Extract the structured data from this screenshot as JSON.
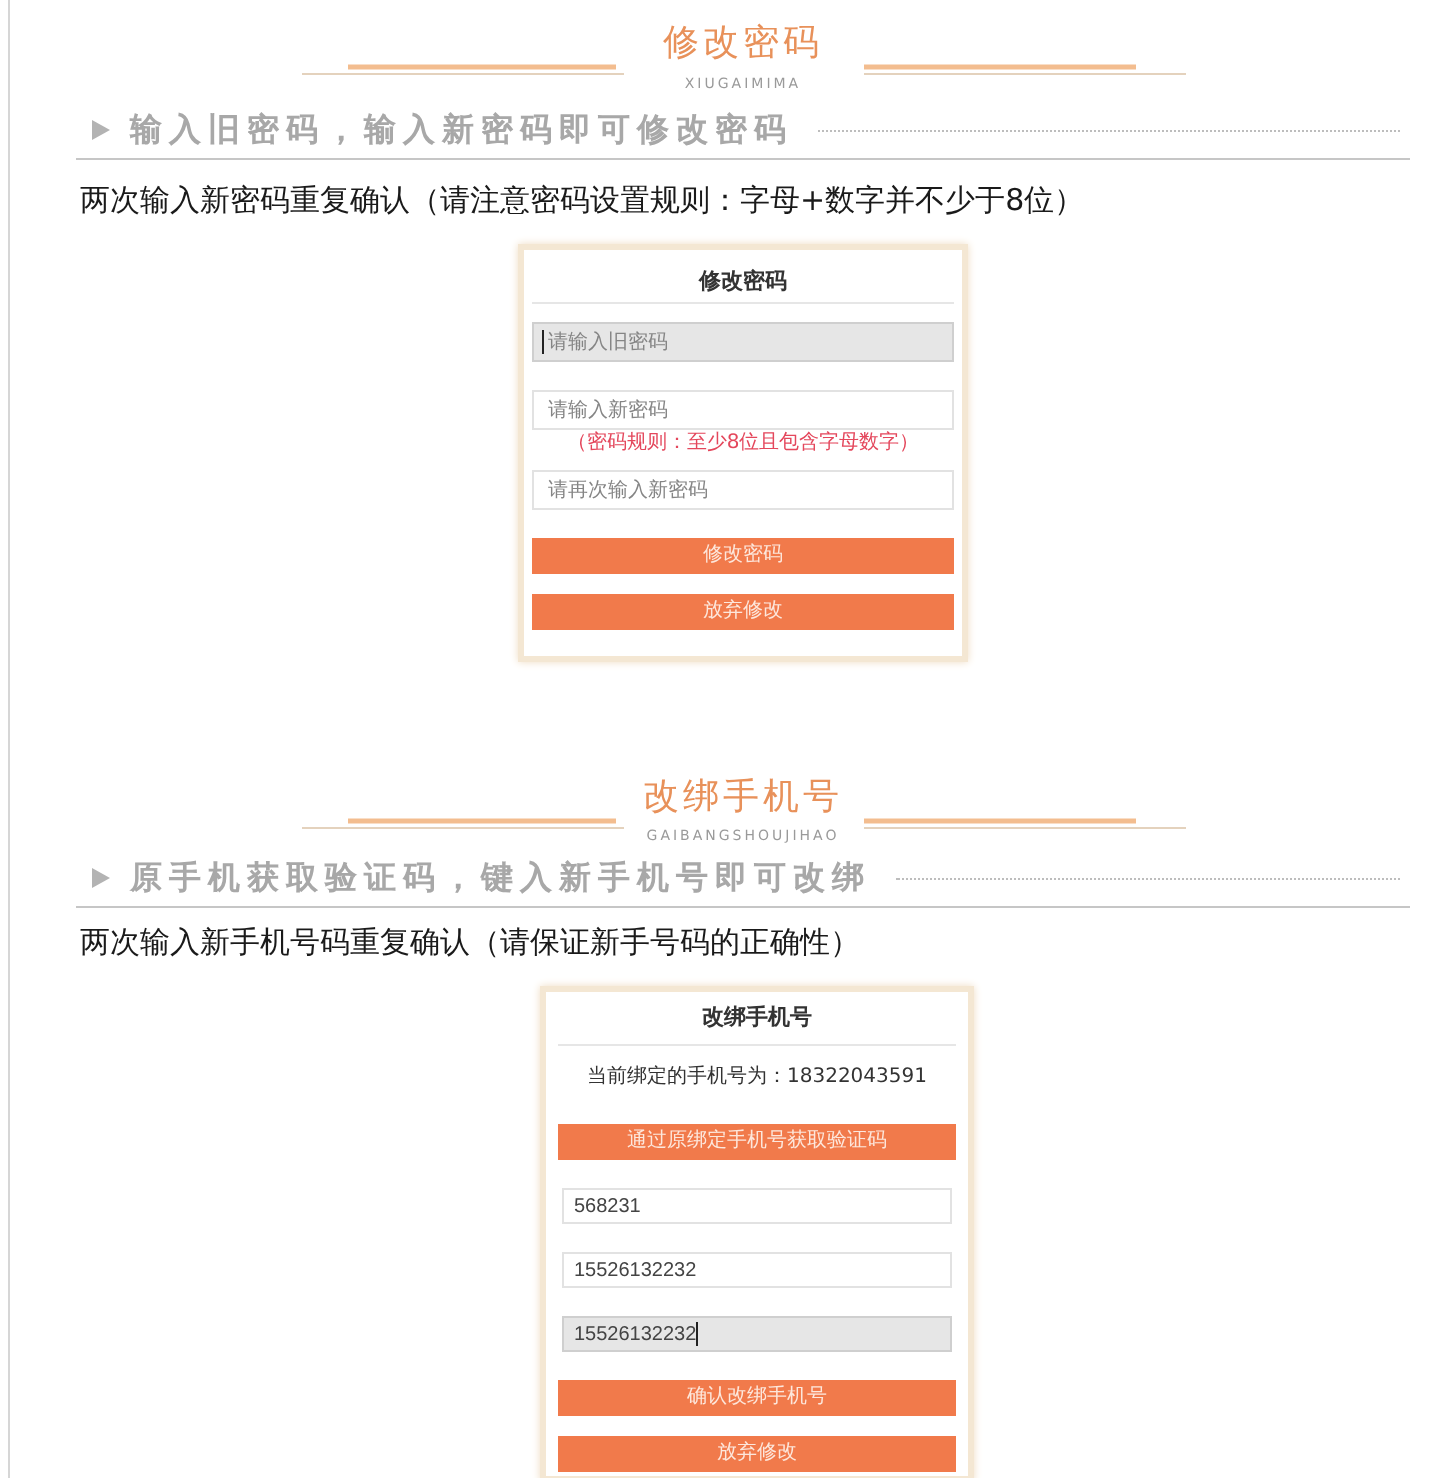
{
  "sections": [
    {
      "title": "修改密码",
      "pinyin": "XIUGAIMIMA",
      "subheading": "输入旧密码，输入新密码即可修改密码",
      "description": "两次输入新密码重复确认（请注意密码设置规则：字母+数字并不少于8位）",
      "form": {
        "title": "修改密码",
        "items": [
          {
            "kind": "field",
            "placeholder": "请输入旧密码",
            "focused": true
          },
          {
            "kind": "field",
            "placeholder": "请输入新密码",
            "focused": false
          },
          {
            "kind": "hint",
            "text": "（密码规则：至少8位且包含字母数字）"
          },
          {
            "kind": "field",
            "placeholder": "请再次输入新密码",
            "focused": false
          },
          {
            "kind": "button",
            "label": "修改密码"
          },
          {
            "kind": "button",
            "label": "放弃修改"
          }
        ]
      }
    },
    {
      "title": "改绑手机号",
      "pinyin": "GAIBANGSHOUJIHAO",
      "subheading": "原手机获取验证码，键入新手机号即可改绑",
      "description": "两次输入新手机号码重复确认（请保证新手号码的正确性）",
      "form": {
        "title": "改绑手机号",
        "items": [
          {
            "kind": "note",
            "text": "当前绑定的手机号为：18322043591"
          },
          {
            "kind": "button",
            "label": "通过原绑定手机号获取验证码"
          },
          {
            "kind": "field",
            "value": "568231",
            "focused": false
          },
          {
            "kind": "field",
            "value": "15526132232",
            "focused": false
          },
          {
            "kind": "field",
            "value": "15526132232",
            "focused": true
          },
          {
            "kind": "button",
            "label": "确认改绑手机号"
          },
          {
            "kind": "button",
            "label": "放弃修改"
          }
        ]
      }
    }
  ]
}
